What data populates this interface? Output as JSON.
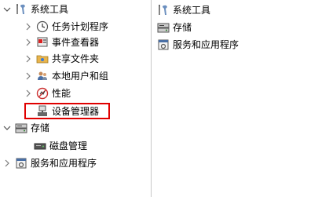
{
  "tree": {
    "root": {
      "label": "系统工具",
      "icon": "tools-icon",
      "expanded": true
    },
    "children": [
      {
        "label": "任务计划程序",
        "icon": "clock-icon"
      },
      {
        "label": "事件查看器",
        "icon": "event-viewer-icon"
      },
      {
        "label": "共享文件夹",
        "icon": "shared-folder-icon"
      },
      {
        "label": "本地用户和组",
        "icon": "users-icon"
      },
      {
        "label": "性能",
        "icon": "performance-icon"
      },
      {
        "label": "设备管理器",
        "icon": "device-manager-icon",
        "highlighted": true
      }
    ],
    "storage": {
      "label": "存储",
      "icon": "storage-icon",
      "expanded": true
    },
    "storage_children": [
      {
        "label": "磁盘管理",
        "icon": "disk-icon"
      }
    ],
    "services": {
      "label": "服务和应用程序",
      "icon": "services-icon",
      "expanded": false
    }
  },
  "list": {
    "items": [
      {
        "label": "系统工具",
        "icon": "tools-icon"
      },
      {
        "label": "存储",
        "icon": "storage-icon"
      },
      {
        "label": "服务和应用程序",
        "icon": "services-icon"
      }
    ]
  },
  "colors": {
    "highlight_border": "#e00000",
    "chevron": "#7a7a7a"
  }
}
